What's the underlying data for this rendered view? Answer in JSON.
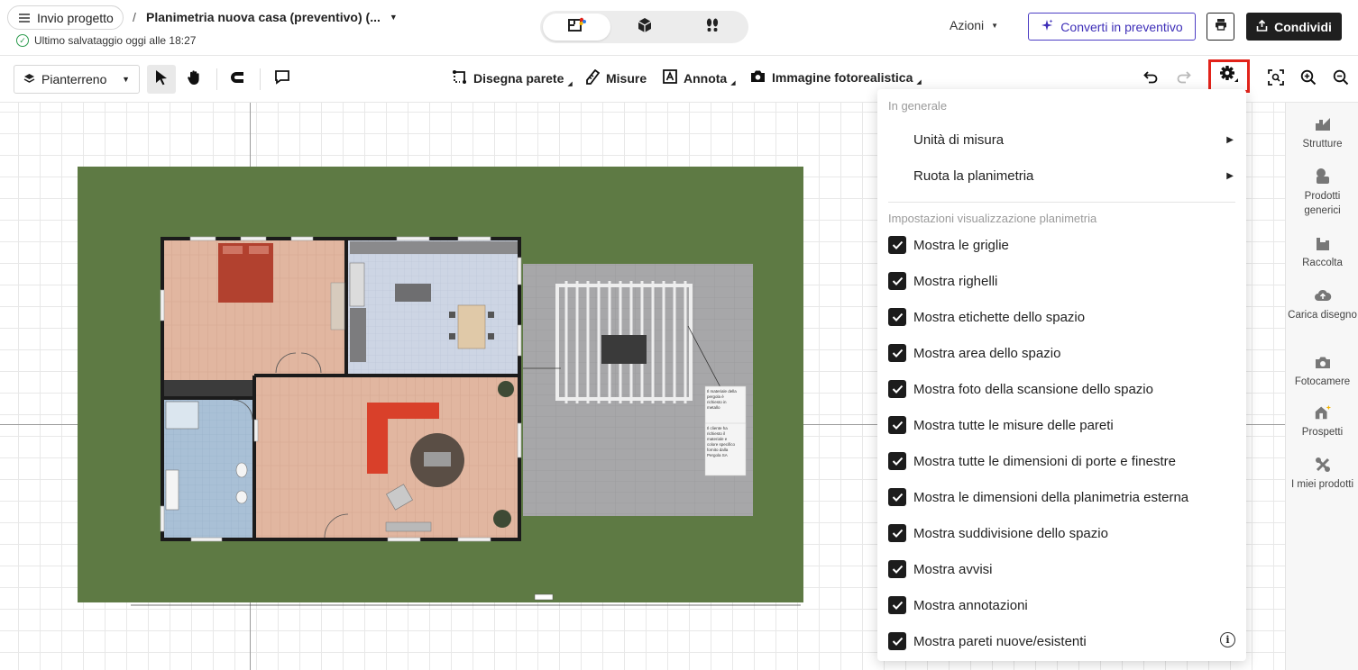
{
  "header": {
    "back_label": "Invio progetto",
    "breadcrumb_sep": "/",
    "project_title": "Planimetria nuova casa (preventivo) (...",
    "save_status": "Ultimo salvataggio oggi alle 18:27",
    "actions_label": "Azioni",
    "convert_label": "Converti in preventivo",
    "share_label": "Condividi",
    "view_modes": [
      "2d-plan-icon",
      "3d-box-icon",
      "walk-footprints-icon"
    ],
    "active_view": 0
  },
  "toolbar": {
    "floor": "Pianterreno",
    "draw_wall": "Disegna parete",
    "measures": "Misure",
    "annotate": "Annota",
    "photo_image": "Immagine fotorealistica"
  },
  "rail": {
    "items": [
      {
        "label": "Strutture",
        "icon": "structures-icon"
      },
      {
        "label": "Prodotti generici",
        "icon": "generic-products-icon"
      },
      {
        "label": "Raccolta",
        "icon": "collection-icon"
      },
      {
        "label": "Carica disegno",
        "icon": "upload-drawing-icon"
      },
      {
        "label": "Fotocamere",
        "icon": "camera-icon"
      },
      {
        "label": "Prospetti",
        "icon": "elevations-icon"
      },
      {
        "label": "I miei prodotti",
        "icon": "my-products-icon"
      }
    ]
  },
  "settings_menu": {
    "general_title": "In generale",
    "units": "Unità di misura",
    "rotate": "Ruota la planimetria",
    "display_title": "Impostazioni visualizzazione planimetria",
    "options": [
      {
        "label": "Mostra le griglie",
        "checked": true
      },
      {
        "label": "Mostra righelli",
        "checked": true
      },
      {
        "label": "Mostra etichette dello spazio",
        "checked": true
      },
      {
        "label": "Mostra area dello spazio",
        "checked": true
      },
      {
        "label": "Mostra foto della scansione dello spazio",
        "checked": true
      },
      {
        "label": "Mostra tutte le misure delle pareti",
        "checked": true
      },
      {
        "label": "Mostra tutte le dimensioni di porte e finestre",
        "checked": true
      },
      {
        "label": "Mostra le dimensioni della planimetria esterna",
        "checked": true
      },
      {
        "label": "Mostra suddivisione dello spazio",
        "checked": true
      },
      {
        "label": "Mostra avvisi",
        "checked": true
      },
      {
        "label": "Mostra annotazioni",
        "checked": true
      },
      {
        "label": "Mostra pareti nuove/esistenti",
        "checked": true
      }
    ]
  },
  "plan": {
    "notes": [
      [
        "Il materiale della",
        "pergola è",
        "richiesto in",
        "metallo"
      ],
      [
        "Il cliente ha",
        "richiesto il",
        "materiale e",
        "colore specifico",
        "fornito dalla",
        "Pergola SA"
      ]
    ],
    "colors": {
      "lawn": "#5e7a44",
      "wood": "#e1b6a0",
      "tile": "#c9d2e2",
      "patio": "#a9a9ab",
      "sofa": "#d9402a"
    }
  }
}
